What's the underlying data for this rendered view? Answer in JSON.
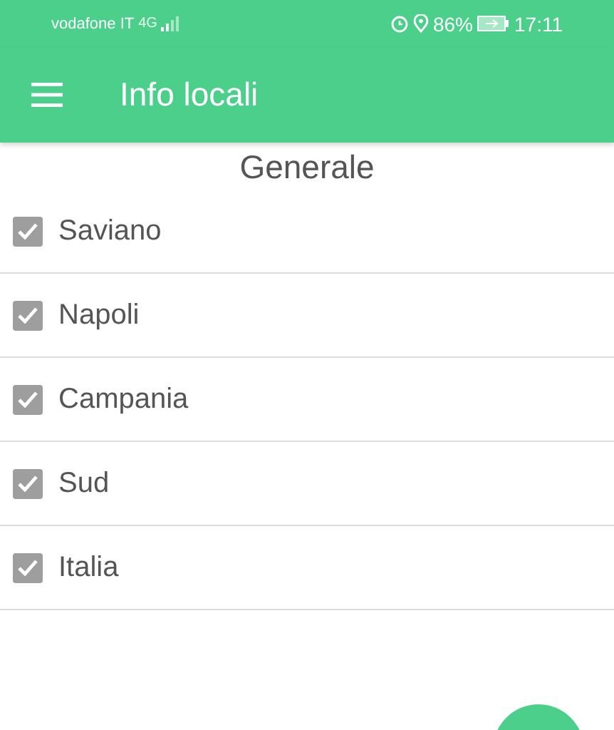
{
  "status_bar": {
    "carrier": "vodafone IT",
    "network": "4G",
    "battery": "86%",
    "time": "17:11"
  },
  "app_bar": {
    "title": "Info locali"
  },
  "section": {
    "title": "Generale"
  },
  "items": [
    {
      "label": "Saviano",
      "checked": true
    },
    {
      "label": "Napoli",
      "checked": true
    },
    {
      "label": "Campania",
      "checked": true
    },
    {
      "label": "Sud",
      "checked": true
    },
    {
      "label": "Italia",
      "checked": true
    }
  ]
}
